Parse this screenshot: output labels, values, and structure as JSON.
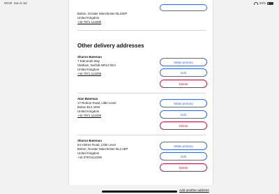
{
  "status_bar": {
    "time": "00:00",
    "date": "Sun 6 Jul",
    "url": "settings3.ebay.co.uk",
    "battery": "93%"
  },
  "primary_address": {
    "lines": [
      "Bolton, Greater Manchester BL31EP",
      "United Kingdom"
    ],
    "phone": "+44 7971 112209"
  },
  "section_title": "Other delivery addresses",
  "addresses": [
    {
      "name": "Sharon Bateman",
      "lines": [
        "7 Edmonds Way",
        "Statham, Norfolk NR12 9GA",
        "United Kingdom"
      ],
      "phone": "+44 7971 112209"
    },
    {
      "name": "Alan Bateman",
      "lines": [
        "17 Redcar Road, Little Lever",
        "Bolton BL3 1EW",
        "United Kingdom"
      ],
      "phone": "+44 7971 112209"
    },
    {
      "name": "Sharon Bateman",
      "lines": [
        "64 Aintree Road, Little Lever",
        "Bolton, Greater Manchester BL3 1EP",
        "United Kingdom"
      ],
      "phone": "+44 07971112209"
    }
  ],
  "buttons": {
    "make_primary": "Make primary",
    "edit": "Edit",
    "delete": "Delete"
  },
  "add_another": "Add another address",
  "colors": {
    "primary": "#3665f3",
    "danger": "#e0103a"
  }
}
